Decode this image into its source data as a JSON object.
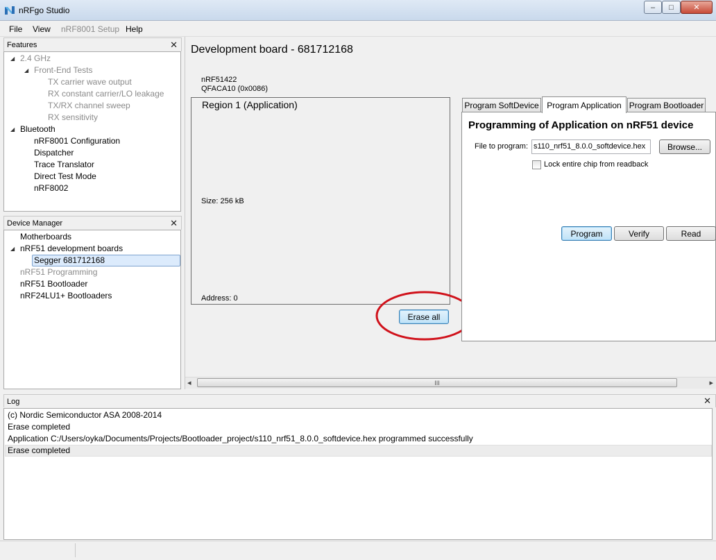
{
  "window": {
    "title": "nRFgo Studio",
    "minimize_glyph": "–",
    "maximize_glyph": "□",
    "close_glyph": "✕"
  },
  "menu": {
    "items": [
      {
        "label": "File",
        "enabled": true
      },
      {
        "label": "View",
        "enabled": true
      },
      {
        "label": "nRF8001 Setup",
        "enabled": false
      },
      {
        "label": "Help",
        "enabled": true
      }
    ]
  },
  "features": {
    "title": "Features",
    "close_glyph": "✕",
    "items": [
      {
        "label": "2.4 GHz",
        "enabled": false
      },
      {
        "label": "Front-End Tests",
        "enabled": false
      },
      {
        "label": "TX carrier wave output",
        "enabled": false
      },
      {
        "label": "RX constant carrier/LO leakage",
        "enabled": false
      },
      {
        "label": "TX/RX channel sweep",
        "enabled": false
      },
      {
        "label": "RX sensitivity",
        "enabled": false
      },
      {
        "label": "Bluetooth",
        "enabled": true
      },
      {
        "label": "nRF8001 Configuration",
        "enabled": true
      },
      {
        "label": "Dispatcher",
        "enabled": true
      },
      {
        "label": "Trace Translator",
        "enabled": true
      },
      {
        "label": "Direct Test Mode",
        "enabled": true
      },
      {
        "label": "nRF8002",
        "enabled": true
      }
    ]
  },
  "device_manager": {
    "title": "Device Manager",
    "close_glyph": "✕",
    "items": [
      {
        "label": "Motherboards",
        "enabled": true
      },
      {
        "label": "nRF51 development boards",
        "enabled": true
      },
      {
        "label": "Segger 681712168",
        "enabled": true,
        "selected": true
      },
      {
        "label": "nRF51 Programming",
        "enabled": false
      },
      {
        "label": "nRF51 Bootloader",
        "enabled": true
      },
      {
        "label": "nRF24LU1+ Bootloaders",
        "enabled": true
      }
    ]
  },
  "main": {
    "title": "Development board - 681712168",
    "chip_name": "nRF51422",
    "chip_variant": "QFACA10 (0x0086)",
    "region": {
      "title": "Region 1 (Application)",
      "size_text": "Size:  256 kB",
      "address_text": "Address:   0"
    },
    "erase_all_label": "Erase all",
    "tabs": [
      {
        "label": "Program SoftDevice",
        "active": false
      },
      {
        "label": "Program Application",
        "active": true
      },
      {
        "label": "Program Bootloader",
        "active": false
      }
    ],
    "programming": {
      "heading": "Programming of Application on nRF51 device",
      "file_label": "File to program:",
      "file_value": "s110_nrf51_8.0.0_softdevice.hex",
      "browse_label": "Browse...",
      "lock_label": "Lock entire chip from readback",
      "lock_checked": false,
      "program_label": "Program",
      "verify_label": "Verify",
      "read_label": "Read"
    },
    "scrollbar_grip": "III",
    "scroll_left_glyph": "◂",
    "scroll_right_glyph": "▸"
  },
  "log": {
    "title": "Log",
    "close_glyph": "✕",
    "lines": [
      "(c) Nordic Semiconductor ASA 2008-2014",
      "Erase completed",
      "Application C:/Users/oyka/Documents/Projects/Bootloader_project/s110_nrf51_8.0.0_softdevice.hex programmed successfully",
      "Erase completed"
    ]
  },
  "colors": {
    "annotation_circle": "#d0121b",
    "selection_bg": "#dcebfc",
    "selection_border": "#7da2ce"
  }
}
